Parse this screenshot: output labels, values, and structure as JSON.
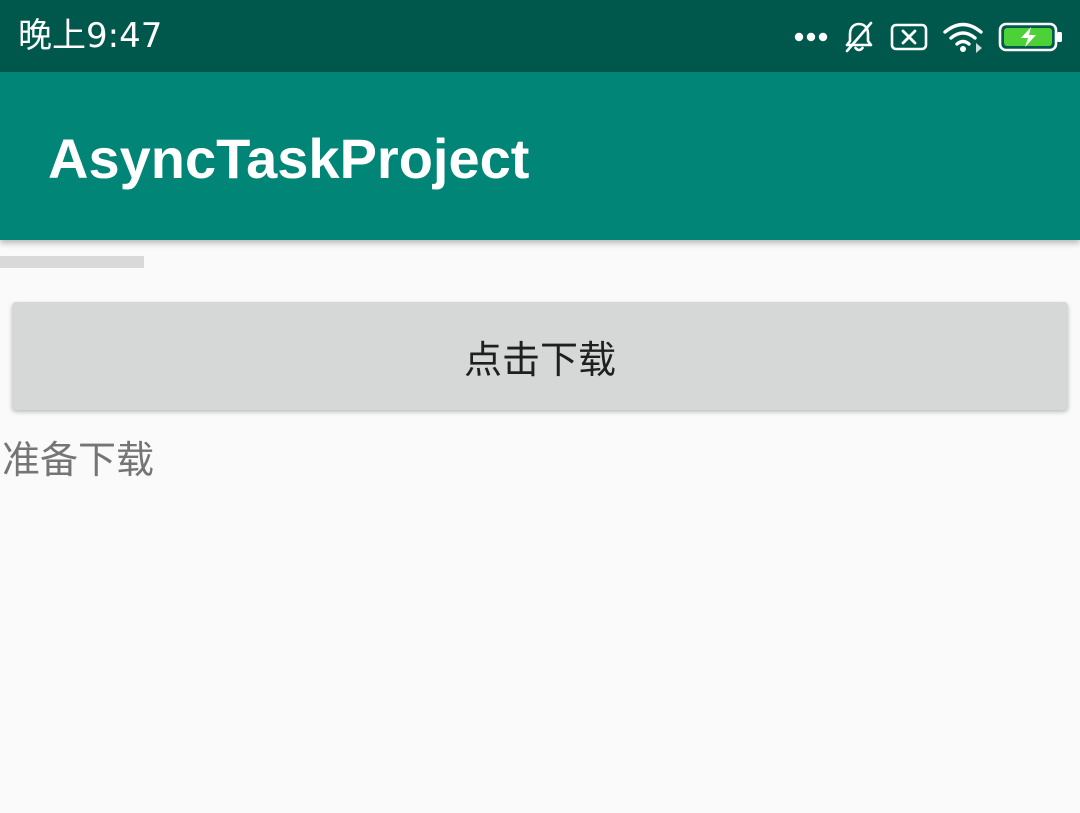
{
  "status_bar": {
    "time": "晚上9:47",
    "icons": [
      "more-dots-icon",
      "notifications-off-icon",
      "sim-disabled-icon",
      "wifi-icon",
      "battery-charging-icon"
    ],
    "battery_color": "#4cd137"
  },
  "app_bar": {
    "title": "AsyncTaskProject",
    "color": "#008577"
  },
  "progress": {
    "value": 0
  },
  "main": {
    "download_button_label": "点击下载",
    "status_text": "准备下载"
  }
}
